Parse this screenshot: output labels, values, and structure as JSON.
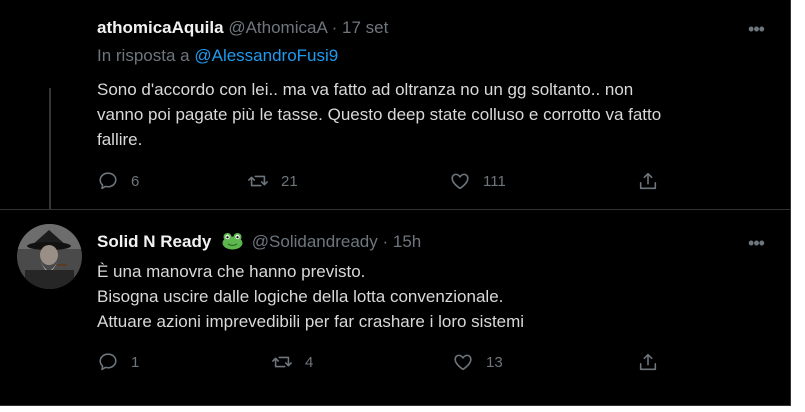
{
  "tweet1": {
    "name": "athomicaAquila",
    "handle": "@AthomicaA",
    "separator": "·",
    "time": "17 set",
    "reply_prefix": "In risposta a",
    "reply_mention": "@AlessandroFusi9",
    "text_lines": [
      "Sono d'accordo con lei.. ma va fatto ad oltranza no un gg soltanto.. non",
      "vanno poi pagate più le tasse. Questo deep state colluso e corrotto va fatto",
      "fallire."
    ],
    "counts": {
      "replies": "6",
      "retweets": "21",
      "likes": "111"
    }
  },
  "tweet2": {
    "name": "Solid N Ready",
    "name_emoji": "frog-emoji",
    "handle": "@Solidandready",
    "separator": "·",
    "time": "15h",
    "text_lines": [
      "È una manovra che hanno previsto.",
      "Bisogna uscire dalle logiche della lotta convenzionale.",
      "Attuare azioni imprevedibili per far crashare i loro sistemi"
    ],
    "counts": {
      "replies": "1",
      "retweets": "4",
      "likes": "13"
    }
  },
  "icons": {
    "reply": "reply-icon",
    "retweet": "retweet-icon",
    "like": "like-icon",
    "share": "share-icon",
    "more": "more-options-icon"
  },
  "colors": {
    "background": "#000000",
    "text": "#d9d9d9",
    "secondary": "#6e767d",
    "link": "#1d9bf0",
    "divider": "#2f3336"
  }
}
